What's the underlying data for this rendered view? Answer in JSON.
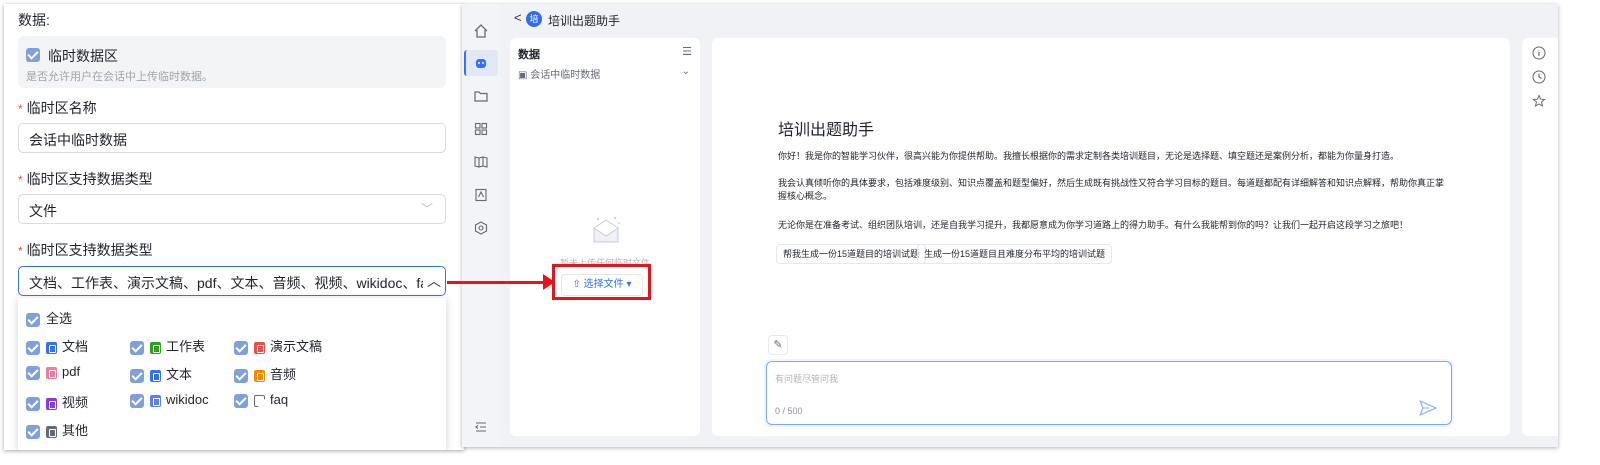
{
  "config": {
    "section_title": "数据:",
    "temp_area": {
      "label": "临时数据区",
      "desc": "是否允许用户在会话中上传临时数据。",
      "checked": true
    },
    "fields": [
      {
        "label": "临时区名称",
        "value": "会话中临时数据"
      },
      {
        "label": "临时区支持数据类型",
        "value": "文件"
      },
      {
        "label": "临时区支持数据类型",
        "value": "文档、工作表、演示文稿、pdf、文本、音频、视频、wikidoc、faq、其"
      }
    ],
    "options": {
      "select_all": "全选",
      "items": [
        {
          "label": "文档",
          "icon": "doc-icon",
          "color": "#3370ff"
        },
        {
          "label": "工作表",
          "icon": "sheet-icon",
          "color": "#2ea121"
        },
        {
          "label": "演示文稿",
          "icon": "slides-icon",
          "color": "#f54a45"
        },
        {
          "label": "pdf",
          "icon": "pdf-icon",
          "color": "#f27a9b"
        },
        {
          "label": "文本",
          "icon": "text-icon",
          "color": "#3370ff"
        },
        {
          "label": "音频",
          "icon": "audio-icon",
          "color": "#ff8800"
        },
        {
          "label": "视频",
          "icon": "video-icon",
          "color": "#7f3bf5"
        },
        {
          "label": "wikidoc",
          "icon": "wikidoc-icon",
          "color": "#5b7ff5"
        },
        {
          "label": "faq",
          "icon": "faq-icon",
          "color": "#646a73"
        },
        {
          "label": "其他",
          "icon": "other-icon",
          "color": "#646a73"
        }
      ]
    }
  },
  "app": {
    "title": "培训出题助手",
    "logo_char": "培",
    "data_panel": {
      "title": "数据",
      "sub": "会话中临时数据",
      "empty": "暂未上传任何临时文件",
      "select_button": "选择文件"
    },
    "chat": {
      "title": "培训出题助手",
      "paragraphs": [
        "你好！我是你的智能学习伙伴，很高兴能为你提供帮助。我擅长根据你的需求定制各类培训题目，无论是选择题、填空题还是案例分析，都能为你量身打造。",
        "我会认真倾听你的具体要求，包括难度级别、知识点覆盖和题型偏好，然后生成既有挑战性又符合学习目标的题目。每道题都配有详细解答和知识点解释，帮助你真正掌握核心概念。",
        "无论你是在准备考试、组织团队培训，还是自我学习提升，我都愿意成为你学习道路上的得力助手。有什么我能帮到你的吗？让我们一起开启这段学习之旅吧！"
      ],
      "suggestions": [
        "帮我生成一份15道题目的培训试题",
        "生成一份15道题目且难度分布平均的培训试题"
      ],
      "input_placeholder": "有问题尽管问我",
      "counter": "0 / 500"
    }
  },
  "colors": {
    "accent": "#3370ff",
    "highlight": "#e4161b",
    "required": "#e5484d"
  }
}
